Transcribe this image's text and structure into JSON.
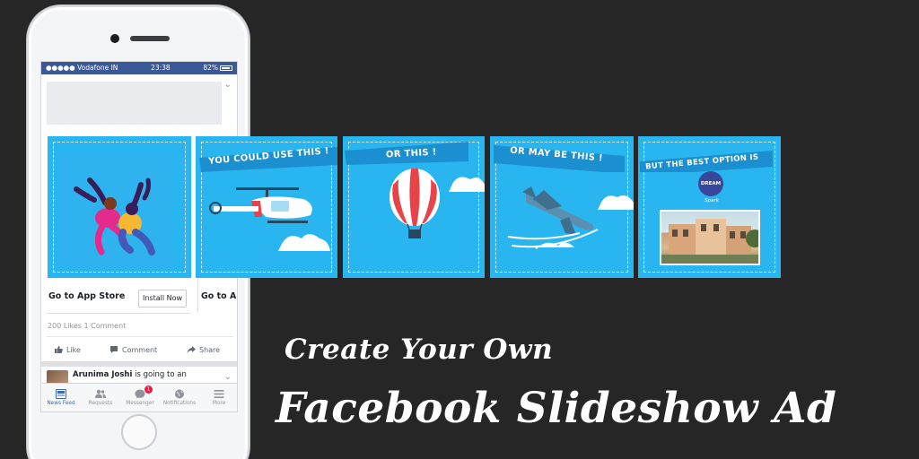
{
  "headline": {
    "line1": "Create Your Own",
    "line2": "Facebook Slideshow Ad"
  },
  "phone": {
    "status_bar": {
      "carrier": "●●●●● Vodafone IN",
      "time": "23:38",
      "battery": "82%"
    },
    "ad_card": {
      "cta_title": "Go to App Store",
      "cta_title_2": "Go to A",
      "install_button": "Install Now"
    },
    "engagement": {
      "likes": "200 Likes",
      "comments": "1 Comment"
    },
    "actions": [
      "Like",
      "Comment",
      "Share"
    ],
    "next_post": {
      "author": "Arunima Joshi",
      "text": " is going to an"
    },
    "tabs": [
      {
        "label": "News Feed",
        "icon": "news-feed-icon"
      },
      {
        "label": "Requests",
        "icon": "friend-requests-icon"
      },
      {
        "label": "Messenger",
        "icon": "messenger-icon",
        "badge": "1"
      },
      {
        "label": "Notifications",
        "icon": "globe-icon"
      },
      {
        "label": "More",
        "icon": "menu-icon"
      }
    ]
  },
  "slides": [
    {
      "banner": ""
    },
    {
      "banner": "YOU COULD USE THIS !"
    },
    {
      "banner": "OR THIS !"
    },
    {
      "banner": "OR MAY BE THIS !"
    },
    {
      "banner": "BUT THE BEST OPTION IS",
      "brand": "DREAM",
      "brand_sub": "Spark"
    }
  ],
  "colors": {
    "slide_blue": "#29b6f0",
    "banner_blue": "#1c8fd1",
    "facebook_blue": "#3b5998",
    "background": "#262626"
  }
}
